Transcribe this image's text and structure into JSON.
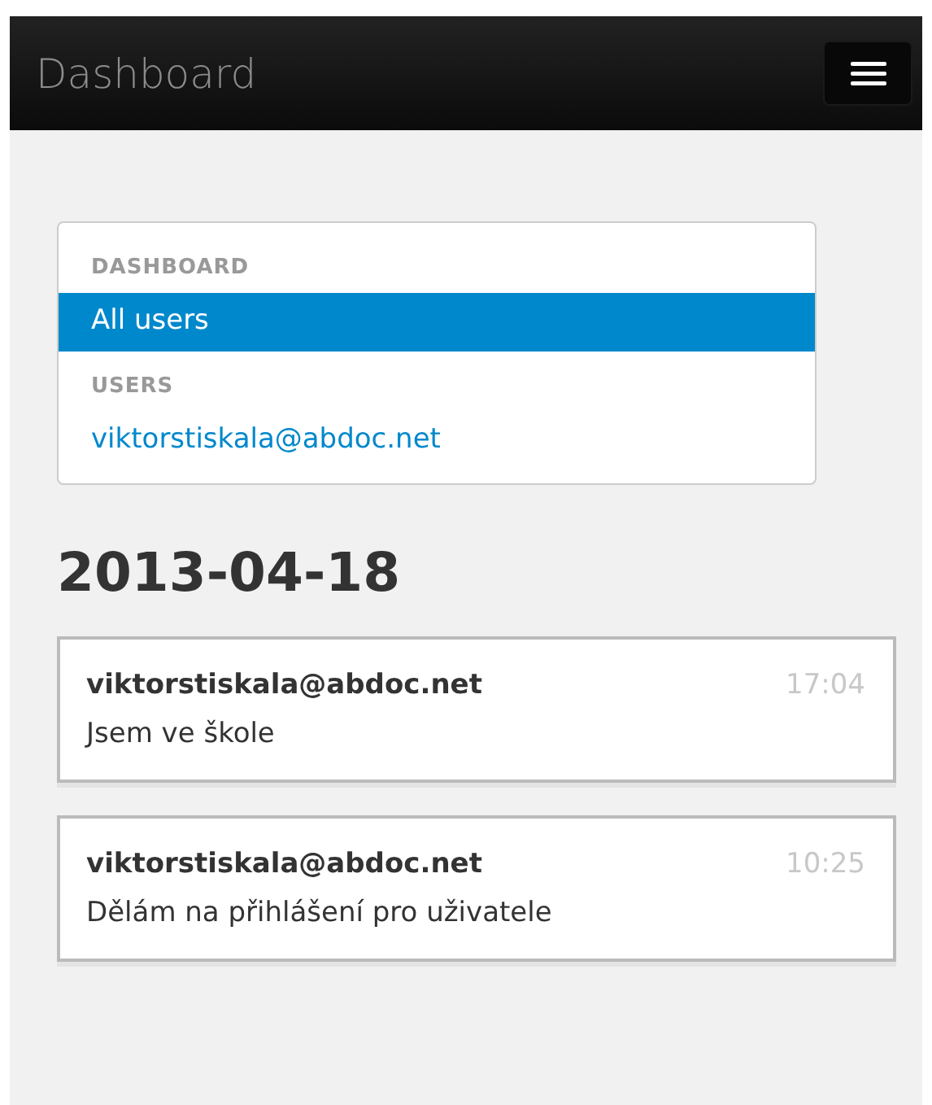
{
  "navbar": {
    "brand": "Dashboard"
  },
  "sidebar": {
    "items": [
      {
        "kind": "header",
        "label": "DASHBOARD"
      },
      {
        "kind": "link",
        "label": "All users",
        "selected": true
      },
      {
        "kind": "header",
        "label": "USERS"
      },
      {
        "kind": "link",
        "label": "viktorstiskala@abdoc.net",
        "selected": false
      }
    ]
  },
  "date_heading": "2013-04-18",
  "entries": [
    {
      "author": "viktorstiskala@abdoc.net",
      "time": "17:04",
      "text": "Jsem ve škole"
    },
    {
      "author": "viktorstiskala@abdoc.net",
      "time": "10:25",
      "text": "Dělám na přihlášení pro uživatele"
    }
  ]
}
